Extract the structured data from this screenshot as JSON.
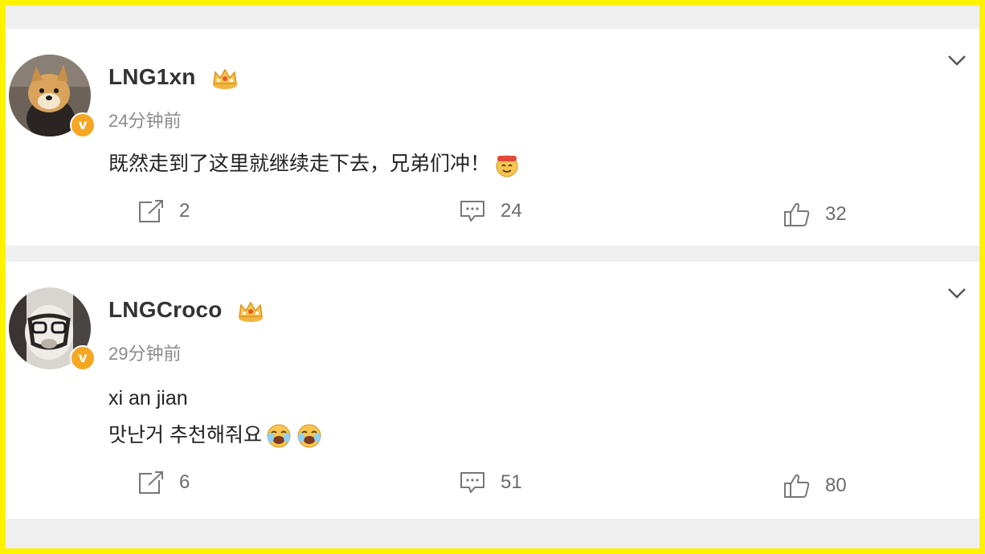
{
  "comments": [
    {
      "username": "LNG1xn",
      "timestamp": "24分钟前",
      "content_lines": [
        "既然走到了这里就继续走下去，兄弟们冲！"
      ],
      "share_count": "2",
      "comment_count": "24",
      "like_count": "32",
      "badge_icon": "crown-icon",
      "verified_icon": "verified-v-icon"
    },
    {
      "username": "LNGCroco",
      "timestamp": "29分钟前",
      "content_lines": [
        "xi an jian",
        "맛난거 추천해줘요"
      ],
      "share_count": "6",
      "comment_count": "51",
      "like_count": "80",
      "badge_icon": "crown-icon",
      "verified_icon": "verified-v-icon"
    }
  ],
  "colors": {
    "frame": "#fff200",
    "verified_badge": "#f5a623",
    "username": "#333333",
    "secondary_text": "#8a8a8a",
    "action_text": "#6b6b6b"
  }
}
